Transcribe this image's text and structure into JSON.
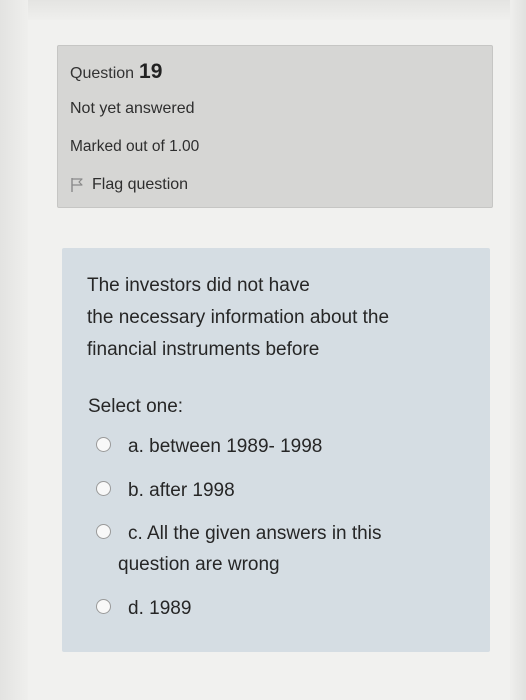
{
  "info": {
    "question_label": "Question",
    "question_number": "19",
    "state": "Not yet answered",
    "grade": "Marked out of 1.00",
    "flag_label": "Flag question",
    "flag_icon": "flag-icon"
  },
  "question": {
    "text_lines": [
      "The investors did not have",
      "the necessary information about the",
      "financial instruments before"
    ],
    "prompt": "Select one:",
    "options": [
      {
        "lines": [
          "a. between 1989- 1998"
        ],
        "selected": false
      },
      {
        "lines": [
          "b. after 1998"
        ],
        "selected": false
      },
      {
        "lines": [
          "c. All the given answers in this",
          "question are wrong"
        ],
        "selected": false
      },
      {
        "lines": [
          "d. 1989"
        ],
        "selected": false
      }
    ]
  },
  "colors": {
    "info_bg": "#d6d6d4",
    "content_bg": "#d5dde3",
    "page_bg": "#f1f1ef"
  }
}
